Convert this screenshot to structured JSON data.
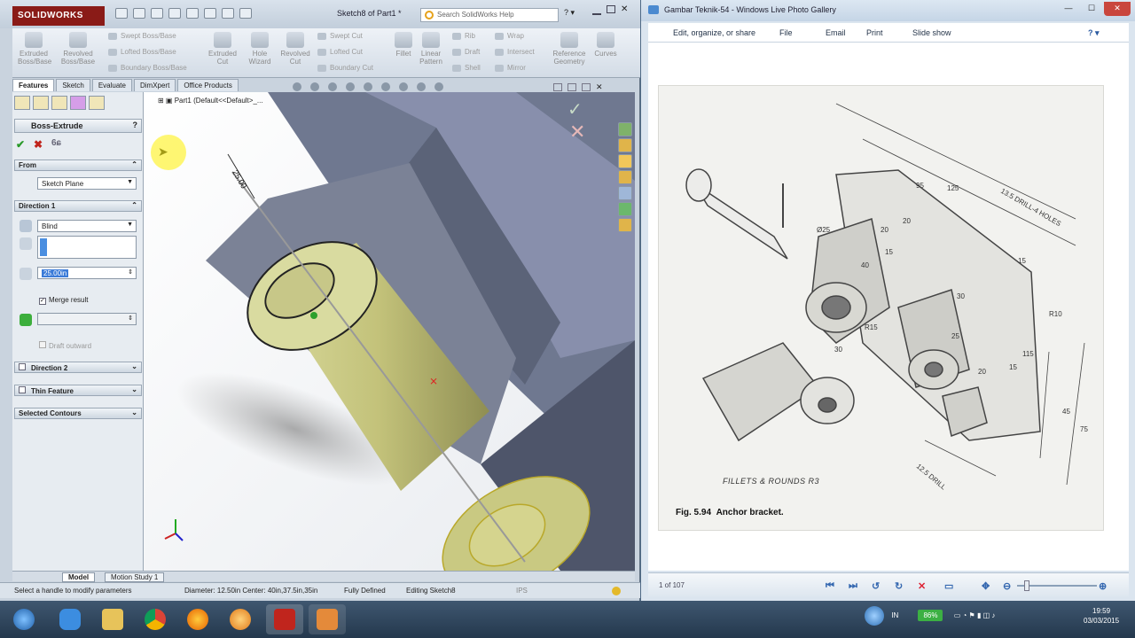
{
  "solidworks": {
    "logo": "SOLIDWORKS",
    "doc_title": "Sketch8 of Part1 *",
    "search_placeholder": "Search SolidWorks Help",
    "ribbon": {
      "extruded_boss": "Extruded Boss/Base",
      "revolved_boss": "Revolved Boss/Base",
      "swept_boss": "Swept Boss/Base",
      "lofted_boss": "Lofted Boss/Base",
      "boundary_boss": "Boundary Boss/Base",
      "extruded_cut": "Extruded Cut",
      "hole_wizard": "Hole Wizard",
      "revolved_cut": "Revolved Cut",
      "swept_cut": "Swept Cut",
      "lofted_cut": "Lofted Cut",
      "boundary_cut": "Boundary Cut",
      "fillet": "Fillet",
      "linear_pattern": "Linear Pattern",
      "rib": "Rib",
      "draft": "Draft",
      "shell": "Shell",
      "wrap": "Wrap",
      "intersect": "Intersect",
      "mirror": "Mirror",
      "reference_geometry": "Reference Geometry",
      "curves": "Curves"
    },
    "cm_tabs": [
      "Features",
      "Sketch",
      "Evaluate",
      "DimXpert",
      "Office Products"
    ],
    "pm": {
      "title": "Boss-Extrude",
      "from_label": "From",
      "from_value": "Sketch Plane",
      "dir1_label": "Direction 1",
      "dir1_value": "Blind",
      "depth_value": "25.00in",
      "merge_result": "Merge result",
      "draft_outward": "Draft outward",
      "direction2": "Direction 2",
      "thin_feature": "Thin Feature",
      "selected_contours": "Selected Contours"
    },
    "tree_root": "Part1  (Default<<Default>_...",
    "dim_label": "25.00",
    "bottom_tabs": [
      "Model",
      "Motion Study 1"
    ],
    "status": {
      "hint": "Select a handle to modify parameters",
      "geometry": "Diameter: 12.50in  Center: 40in,37.5in,35in",
      "defined": "Fully Defined",
      "editing": "Editing Sketch8",
      "units": "IPS"
    }
  },
  "gallery": {
    "title": "Gambar Teknik-54 - Windows Live Photo Gallery",
    "menu": [
      "Edit, organize, or share",
      "File",
      "Email",
      "Print",
      "Slide show"
    ],
    "caption_fig": "Fig. 5.94",
    "caption_text": "Anchor bracket.",
    "fillets_note": "FILLETS & ROUNDS R3",
    "dims": [
      "95",
      "125",
      "13.5 DRILL-4 HOLES",
      "15",
      "20",
      "20",
      "15",
      "R10",
      "30",
      "Ø25",
      "25",
      "45",
      "75",
      "12.5 DRILL",
      "40",
      "115",
      "15",
      "20",
      "30",
      "R15"
    ],
    "counter": "1 of 107"
  },
  "taskbar": {
    "battery": "86%",
    "lang": "IN",
    "time": "19:59",
    "date": "03/03/2015"
  }
}
